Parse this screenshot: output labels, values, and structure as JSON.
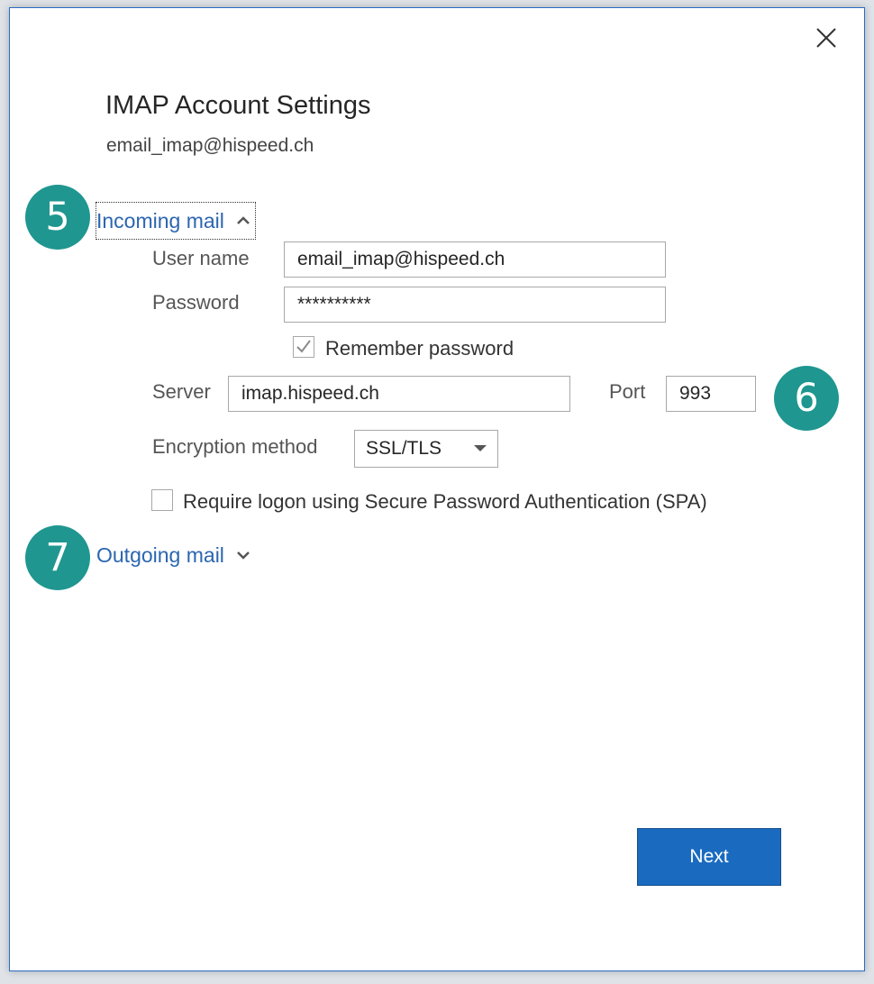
{
  "dialog": {
    "title": "IMAP Account Settings",
    "account_email": "email_imap@hispeed.ch"
  },
  "badges": {
    "incoming": "5",
    "port": "6",
    "outgoing": "7"
  },
  "incoming": {
    "section_label": "Incoming mail",
    "expanded": true,
    "username_label": "User name",
    "username_value": "email_imap@hispeed.ch",
    "password_label": "Password",
    "password_value": "**********",
    "remember_label": "Remember password",
    "remember_checked": true,
    "server_label": "Server",
    "server_value": "imap.hispeed.ch",
    "port_label": "Port",
    "port_value": "993",
    "encryption_label": "Encryption method",
    "encryption_value": "SSL/TLS",
    "spa_label": "Require logon using Secure Password Authentication (SPA)",
    "spa_checked": false
  },
  "outgoing": {
    "section_label": "Outgoing mail",
    "expanded": false
  },
  "footer": {
    "next_label": "Next"
  },
  "colors": {
    "accent": "#1a6bc0",
    "link": "#2b66b0",
    "badge": "#1f9690",
    "border": "#2b6cc4"
  },
  "icons": {
    "close": "close-icon",
    "collapse": "chevron-up-icon",
    "expand": "chevron-down-icon",
    "check": "checkmark-icon",
    "dropdown": "dropdown-arrow-icon"
  }
}
